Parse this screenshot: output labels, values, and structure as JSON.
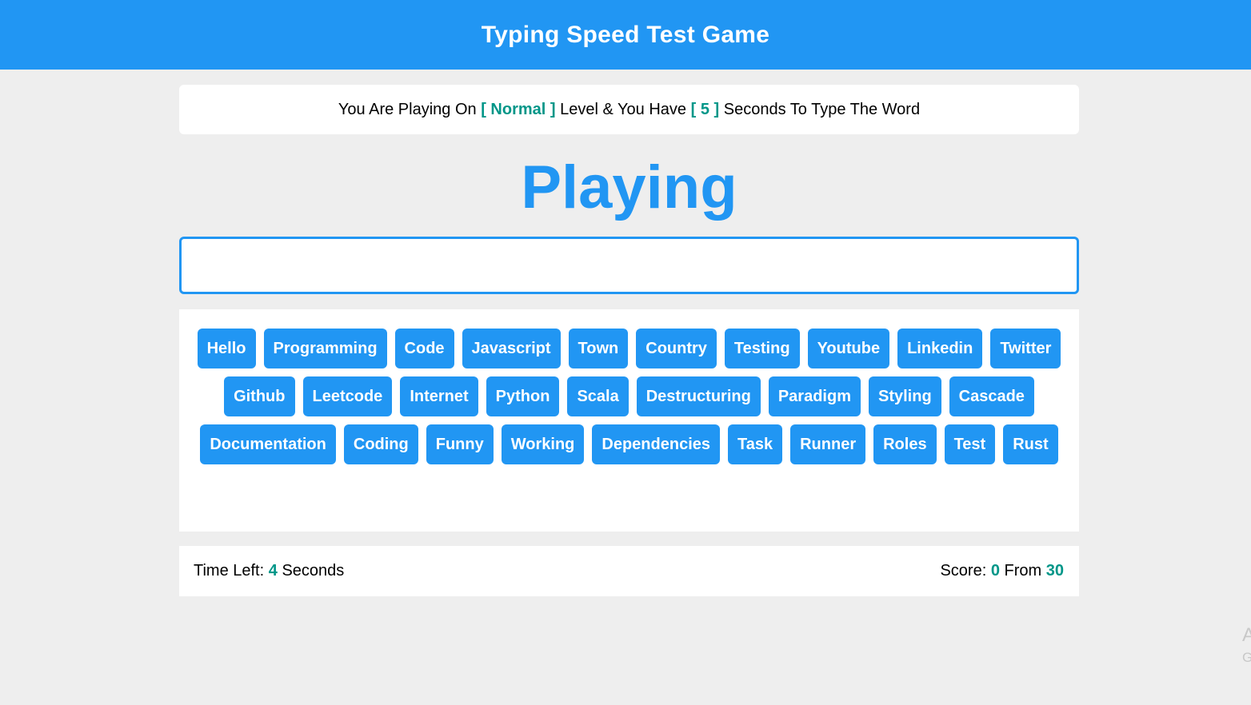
{
  "header": {
    "title": "Typing Speed Test Game"
  },
  "message": {
    "prefix": "You Are Playing On",
    "bracket_open": "[",
    "level": "Normal",
    "bracket_close": "]",
    "middle": "Level & You Have",
    "bracket_open2": "[",
    "seconds": "5",
    "bracket_close2": "]",
    "suffix": "Seconds To Type The Word"
  },
  "game": {
    "current_word": "Playing"
  },
  "input": {
    "value": "",
    "placeholder": ""
  },
  "upcoming_words": [
    "Hello",
    "Programming",
    "Code",
    "Javascript",
    "Town",
    "Country",
    "Testing",
    "Youtube",
    "Linkedin",
    "Twitter",
    "Github",
    "Leetcode",
    "Internet",
    "Python",
    "Scala",
    "Destructuring",
    "Paradigm",
    "Styling",
    "Cascade",
    "Documentation",
    "Coding",
    "Funny",
    "Working",
    "Dependencies",
    "Task",
    "Runner",
    "Roles",
    "Test",
    "Rust"
  ],
  "control": {
    "time_label": "Time Left:",
    "time_value": "4",
    "time_unit": "Seconds",
    "score_label": "Score:",
    "score_value": "0",
    "score_from_label": "From",
    "score_total": "30"
  },
  "corner": {
    "line1": "A",
    "line2": "G"
  },
  "colors": {
    "primary": "#2196f3",
    "accent": "#009688",
    "background": "#eeeeee"
  }
}
